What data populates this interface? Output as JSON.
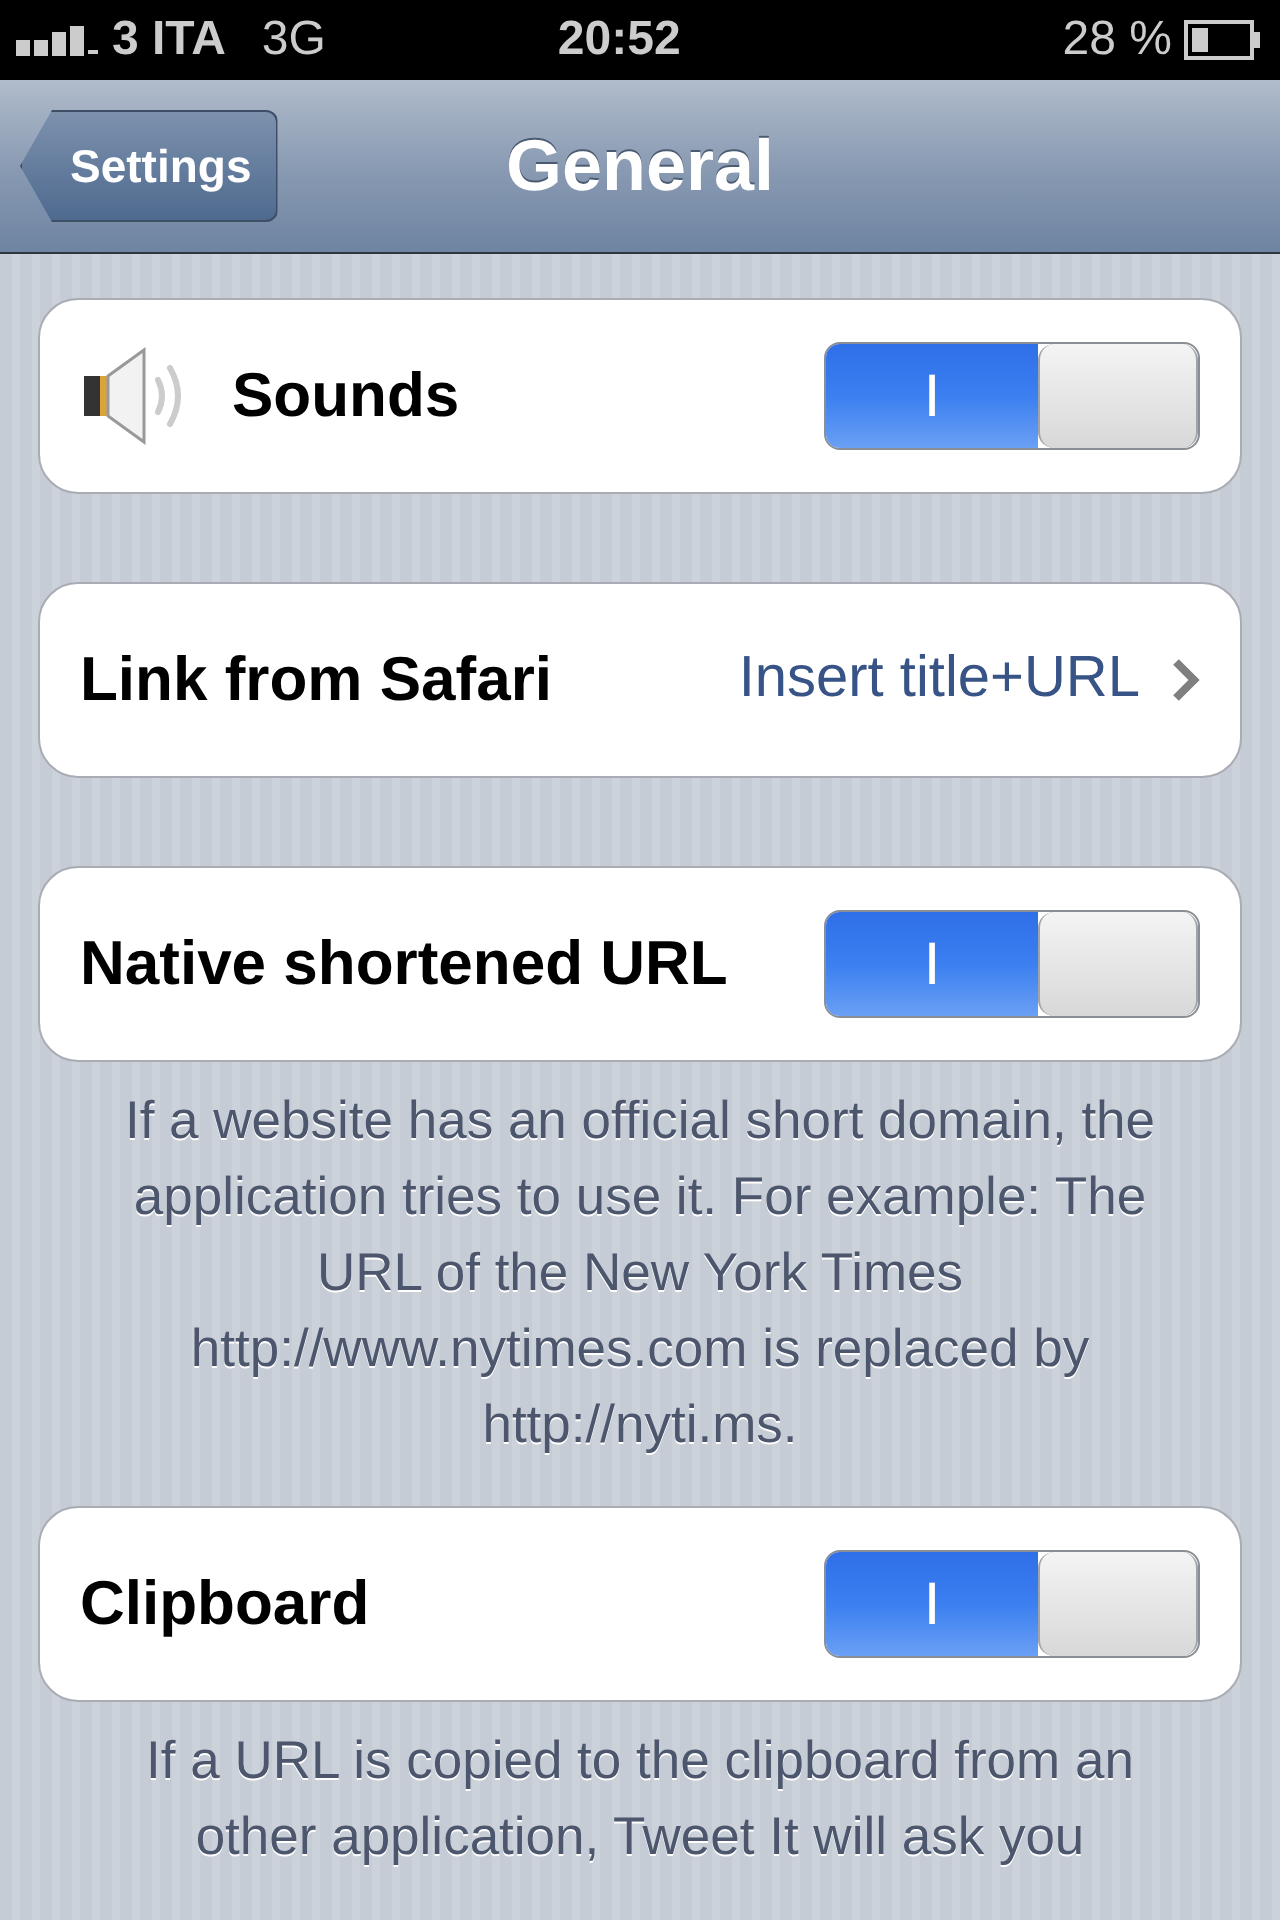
{
  "status_bar": {
    "carrier": "3 ITA",
    "network": "3G",
    "time": "20:52",
    "battery": "28 %"
  },
  "nav": {
    "back": "Settings",
    "title": "General"
  },
  "sections": [
    {
      "kind": "icon_toggle",
      "label": "Sounds",
      "on": true,
      "on_label": "I"
    },
    {
      "kind": "link",
      "label": "Link from Safari",
      "value": "Insert title+URL"
    },
    {
      "kind": "toggle",
      "label": "Native shortened URL",
      "on": true,
      "on_label": "I",
      "footer": "If a website has an official short domain, the application tries to use it. For example: The URL of the New York Times http://www.nytimes.com is replaced by http://nyti.ms."
    },
    {
      "kind": "toggle",
      "label": "Clipboard",
      "on": true,
      "on_label": "I",
      "footer": "If a URL is copied to the clipboard from an other application, Tweet It will ask you"
    }
  ]
}
